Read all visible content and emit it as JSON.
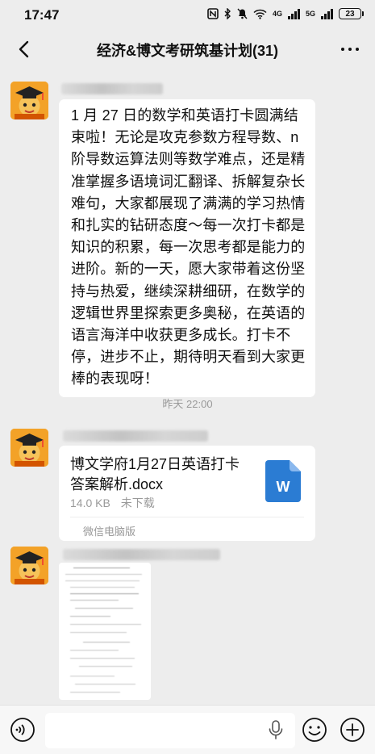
{
  "status": {
    "time": "17:47",
    "network_4g": "4G",
    "network_5g": "5G",
    "battery": "23"
  },
  "header": {
    "title": "经济&博文考研筑基计划(31)"
  },
  "messages": {
    "text_message": "1 月 27 日的数学和英语打卡圆满结束啦！无论是攻克参数方程导数、n 阶导数运算法则等数学难点，还是精准掌握多语境词汇翻译、拆解复杂长难句，大家都展现了满满的学习热情和扎实的钻研态度～每一次打卡都是知识的积累，每一次思考都是能力的进阶。新的一天，愿大家带着这份坚持与热爱，继续深耕细研，在数学的逻辑世界里探索更多奥秘，在英语的语言海洋中收获更多成长。打卡不停，进步不止，期待明天看到大家更棒的表现呀！",
    "timestamp": "昨天 22:00",
    "file": {
      "name": "博文学府1月27日英语打卡答案解析.docx",
      "size": "14.0 KB",
      "status": "未下载",
      "icon_letter": "W",
      "source": "微信电脑版"
    }
  },
  "colors": {
    "background": "#ededed",
    "bubble": "#ffffff",
    "word_blue": "#2b7cd3",
    "avatar_orange": "#f3a228"
  }
}
